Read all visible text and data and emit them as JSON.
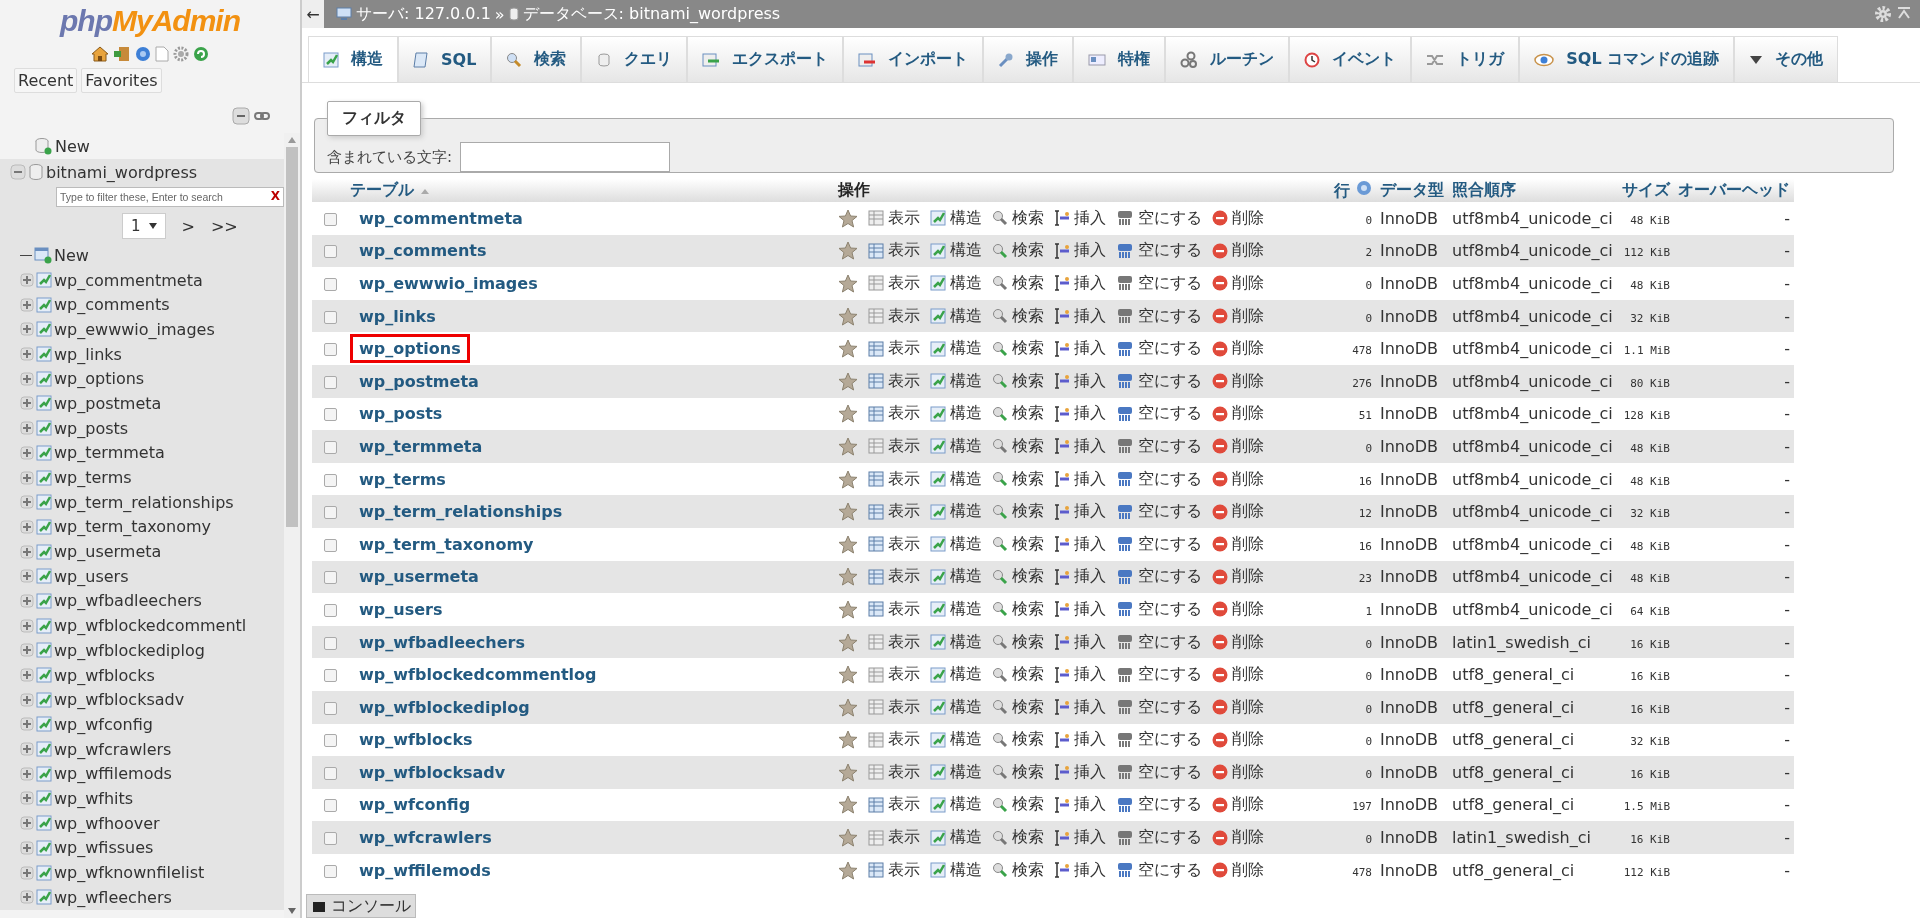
{
  "sidebar": {
    "logo_php": "php",
    "logo_rest": "MyAdmin",
    "tabs": [
      "Recent",
      "Favorites"
    ],
    "tree": {
      "new_label": "New",
      "database": {
        "name": "bitnami_wordpress",
        "expanded": true,
        "filter_placeholder": "Type to filter these, Enter to search",
        "filter_clear": "X",
        "page": "1",
        "next": ">",
        "last": ">>",
        "new_table_label": "New",
        "tables": [
          "wp_commentmeta",
          "wp_comments",
          "wp_ewwwio_images",
          "wp_links",
          "wp_options",
          "wp_postmeta",
          "wp_posts",
          "wp_termmeta",
          "wp_terms",
          "wp_term_relationships",
          "wp_term_taxonomy",
          "wp_usermeta",
          "wp_users",
          "wp_wfbadleechers",
          "wp_wfblockedcommentl",
          "wp_wfblockediplog",
          "wp_wfblocks",
          "wp_wfblocksadv",
          "wp_wfconfig",
          "wp_wfcrawlers",
          "wp_wffilemods",
          "wp_wfhits",
          "wp_wfhoover",
          "wp_wfissues",
          "wp_wfknownfilelist",
          "wp_wfleechers"
        ]
      }
    }
  },
  "breadcrumb": {
    "back": "←",
    "server": "サーバ: 127.0.0.1",
    "separator": "»",
    "database": "データベース: bitnami_wordpress"
  },
  "tabs": [
    {
      "label": "構造",
      "kind": "structure",
      "selected": true
    },
    {
      "label": "SQL",
      "kind": "sql",
      "selected": false
    },
    {
      "label": "検索",
      "kind": "search",
      "selected": false
    },
    {
      "label": "クエリ",
      "kind": "query",
      "selected": false
    },
    {
      "label": "エクスポート",
      "kind": "export",
      "selected": false
    },
    {
      "label": "インポート",
      "kind": "import",
      "selected": false
    },
    {
      "label": "操作",
      "kind": "operations",
      "selected": false
    },
    {
      "label": "特権",
      "kind": "privileges",
      "selected": false
    },
    {
      "label": "ルーチン",
      "kind": "routines",
      "selected": false
    },
    {
      "label": "イベント",
      "kind": "events",
      "selected": false
    },
    {
      "label": "トリガ",
      "kind": "triggers",
      "selected": false
    },
    {
      "label": "SQL コマンドの追跡",
      "kind": "tracking",
      "selected": false
    },
    {
      "label": "その他",
      "kind": "more",
      "selected": false
    }
  ],
  "filter": {
    "legend": "フィルタ",
    "label": "含まれている文字:"
  },
  "table": {
    "columns": [
      "テーブル",
      "操作",
      "行",
      "データ型",
      "照合順序",
      "サイズ",
      "オーバーヘッド"
    ],
    "rows": [
      {
        "name": "wp_commentmeta",
        "checked": false,
        "highlighted": false,
        "empty": true,
        "actions": [
          "表示",
          "構造",
          "検索",
          "挿入",
          "空にする",
          "削除"
        ],
        "rows": "0",
        "engine": "InnoDB",
        "collation": "utf8mb4_unicode_ci",
        "size": "48 KiB",
        "overhead": "-"
      },
      {
        "name": "wp_comments",
        "checked": false,
        "highlighted": false,
        "empty": false,
        "actions": [
          "表示",
          "構造",
          "検索",
          "挿入",
          "空にする",
          "削除"
        ],
        "rows": "2",
        "engine": "InnoDB",
        "collation": "utf8mb4_unicode_ci",
        "size": "112 KiB",
        "overhead": "-"
      },
      {
        "name": "wp_ewwwio_images",
        "checked": false,
        "highlighted": false,
        "empty": true,
        "actions": [
          "表示",
          "構造",
          "検索",
          "挿入",
          "空にする",
          "削除"
        ],
        "rows": "0",
        "engine": "InnoDB",
        "collation": "utf8mb4_unicode_ci",
        "size": "48 KiB",
        "overhead": "-"
      },
      {
        "name": "wp_links",
        "checked": false,
        "highlighted": false,
        "empty": true,
        "actions": [
          "表示",
          "構造",
          "検索",
          "挿入",
          "空にする",
          "削除"
        ],
        "rows": "0",
        "engine": "InnoDB",
        "collation": "utf8mb4_unicode_ci",
        "size": "32 KiB",
        "overhead": "-"
      },
      {
        "name": "wp_options",
        "checked": false,
        "highlighted": true,
        "empty": false,
        "actions": [
          "表示",
          "構造",
          "検索",
          "挿入",
          "空にする",
          "削除"
        ],
        "rows": "478",
        "engine": "InnoDB",
        "collation": "utf8mb4_unicode_ci",
        "size": "1.1 MiB",
        "overhead": "-"
      },
      {
        "name": "wp_postmeta",
        "checked": false,
        "highlighted": false,
        "empty": false,
        "actions": [
          "表示",
          "構造",
          "検索",
          "挿入",
          "空にする",
          "削除"
        ],
        "rows": "276",
        "engine": "InnoDB",
        "collation": "utf8mb4_unicode_ci",
        "size": "80 KiB",
        "overhead": "-"
      },
      {
        "name": "wp_posts",
        "checked": false,
        "highlighted": false,
        "empty": false,
        "actions": [
          "表示",
          "構造",
          "検索",
          "挿入",
          "空にする",
          "削除"
        ],
        "rows": "51",
        "engine": "InnoDB",
        "collation": "utf8mb4_unicode_ci",
        "size": "128 KiB",
        "overhead": "-"
      },
      {
        "name": "wp_termmeta",
        "checked": false,
        "highlighted": false,
        "empty": true,
        "actions": [
          "表示",
          "構造",
          "検索",
          "挿入",
          "空にする",
          "削除"
        ],
        "rows": "0",
        "engine": "InnoDB",
        "collation": "utf8mb4_unicode_ci",
        "size": "48 KiB",
        "overhead": "-"
      },
      {
        "name": "wp_terms",
        "checked": false,
        "highlighted": false,
        "empty": false,
        "actions": [
          "表示",
          "構造",
          "検索",
          "挿入",
          "空にする",
          "削除"
        ],
        "rows": "16",
        "engine": "InnoDB",
        "collation": "utf8mb4_unicode_ci",
        "size": "48 KiB",
        "overhead": "-"
      },
      {
        "name": "wp_term_relationships",
        "checked": false,
        "highlighted": false,
        "empty": false,
        "actions": [
          "表示",
          "構造",
          "検索",
          "挿入",
          "空にする",
          "削除"
        ],
        "rows": "12",
        "engine": "InnoDB",
        "collation": "utf8mb4_unicode_ci",
        "size": "32 KiB",
        "overhead": "-"
      },
      {
        "name": "wp_term_taxonomy",
        "checked": false,
        "highlighted": false,
        "empty": false,
        "actions": [
          "表示",
          "構造",
          "検索",
          "挿入",
          "空にする",
          "削除"
        ],
        "rows": "16",
        "engine": "InnoDB",
        "collation": "utf8mb4_unicode_ci",
        "size": "48 KiB",
        "overhead": "-"
      },
      {
        "name": "wp_usermeta",
        "checked": false,
        "highlighted": false,
        "empty": false,
        "actions": [
          "表示",
          "構造",
          "検索",
          "挿入",
          "空にする",
          "削除"
        ],
        "rows": "23",
        "engine": "InnoDB",
        "collation": "utf8mb4_unicode_ci",
        "size": "48 KiB",
        "overhead": "-"
      },
      {
        "name": "wp_users",
        "checked": false,
        "highlighted": false,
        "empty": false,
        "actions": [
          "表示",
          "構造",
          "検索",
          "挿入",
          "空にする",
          "削除"
        ],
        "rows": "1",
        "engine": "InnoDB",
        "collation": "utf8mb4_unicode_ci",
        "size": "64 KiB",
        "overhead": "-"
      },
      {
        "name": "wp_wfbadleechers",
        "checked": false,
        "highlighted": false,
        "empty": true,
        "actions": [
          "表示",
          "構造",
          "検索",
          "挿入",
          "空にする",
          "削除"
        ],
        "rows": "0",
        "engine": "InnoDB",
        "collation": "latin1_swedish_ci",
        "size": "16 KiB",
        "overhead": "-"
      },
      {
        "name": "wp_wfblockedcommentlog",
        "checked": false,
        "highlighted": false,
        "empty": true,
        "actions": [
          "表示",
          "構造",
          "検索",
          "挿入",
          "空にする",
          "削除"
        ],
        "rows": "0",
        "engine": "InnoDB",
        "collation": "utf8_general_ci",
        "size": "16 KiB",
        "overhead": "-"
      },
      {
        "name": "wp_wfblockediplog",
        "checked": false,
        "highlighted": false,
        "empty": true,
        "actions": [
          "表示",
          "構造",
          "検索",
          "挿入",
          "空にする",
          "削除"
        ],
        "rows": "0",
        "engine": "InnoDB",
        "collation": "utf8_general_ci",
        "size": "16 KiB",
        "overhead": "-"
      },
      {
        "name": "wp_wfblocks",
        "checked": false,
        "highlighted": false,
        "empty": true,
        "actions": [
          "表示",
          "構造",
          "検索",
          "挿入",
          "空にする",
          "削除"
        ],
        "rows": "0",
        "engine": "InnoDB",
        "collation": "utf8_general_ci",
        "size": "32 KiB",
        "overhead": "-"
      },
      {
        "name": "wp_wfblocksadv",
        "checked": false,
        "highlighted": false,
        "empty": true,
        "actions": [
          "表示",
          "構造",
          "検索",
          "挿入",
          "空にする",
          "削除"
        ],
        "rows": "0",
        "engine": "InnoDB",
        "collation": "utf8_general_ci",
        "size": "16 KiB",
        "overhead": "-"
      },
      {
        "name": "wp_wfconfig",
        "checked": false,
        "highlighted": false,
        "empty": false,
        "actions": [
          "表示",
          "構造",
          "検索",
          "挿入",
          "空にする",
          "削除"
        ],
        "rows": "197",
        "engine": "InnoDB",
        "collation": "utf8_general_ci",
        "size": "1.5 MiB",
        "overhead": "-"
      },
      {
        "name": "wp_wfcrawlers",
        "checked": false,
        "highlighted": false,
        "empty": true,
        "actions": [
          "表示",
          "構造",
          "検索",
          "挿入",
          "空にする",
          "削除"
        ],
        "rows": "0",
        "engine": "InnoDB",
        "collation": "latin1_swedish_ci",
        "size": "16 KiB",
        "overhead": "-"
      },
      {
        "name": "wp_wffilemods",
        "checked": false,
        "highlighted": false,
        "empty": false,
        "actions": [
          "表示",
          "構造",
          "検索",
          "挿入",
          "空にする",
          "削除"
        ],
        "rows": "478",
        "engine": "InnoDB",
        "collation": "utf8_general_ci",
        "size": "112 KiB",
        "overhead": "-"
      }
    ]
  },
  "console": {
    "label": "コンソール"
  }
}
